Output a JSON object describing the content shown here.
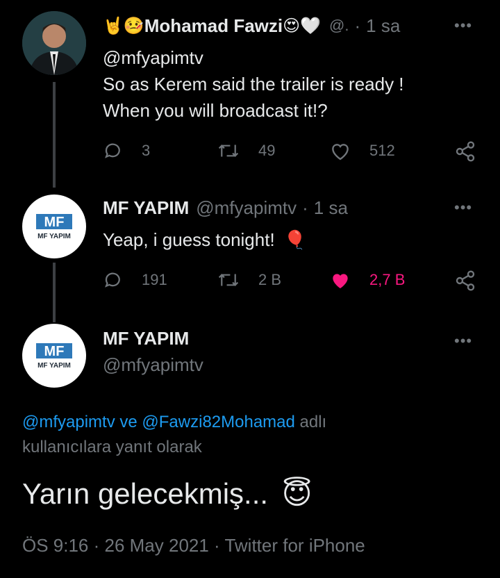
{
  "tweets": [
    {
      "emoji_prefix": "🤘🤒",
      "name": "Mohamad Fawzi",
      "emoji_suffix": "😍🤍",
      "handle": "@.",
      "sep": "·",
      "time": "1 sa",
      "reply_to": "@mfyapimtv",
      "lines": [
        "So as Kerem said the trailer is ready !",
        "When you will broadcast it!?"
      ],
      "replies": "3",
      "retweets": "49",
      "likes": "512"
    },
    {
      "name": "MF YAPIM",
      "handle": "@mfyapimtv",
      "sep": "·",
      "time": "1 sa",
      "text": "Yeap, i guess tonight!",
      "text_emoji": "🎈",
      "replies": "191",
      "retweets": "2 B",
      "likes": "2,7 B",
      "liked": true
    }
  ],
  "main_tweet": {
    "name": "MF YAPIM",
    "handle": "@mfyapimtv",
    "logo_letters": "MF",
    "logo_caption": "MF YAPIM",
    "reply_line1_a": "@mfyapimtv",
    "reply_line1_b": " ve ",
    "reply_line1_c": "@Fawzi82Mohamad",
    "reply_line1_d": " adlı",
    "reply_line2": "kullanıcılara yanıt olarak",
    "text": "Yarın gelecekmiş...",
    "text_emoji": "😇",
    "timestamp": "ÖS 9:16 · 26 May 2021 · Twitter for iPhone"
  },
  "more_label": "•••",
  "colors": {
    "link": "#1d9bf0",
    "like": "#f91880",
    "muted": "#71767b"
  }
}
